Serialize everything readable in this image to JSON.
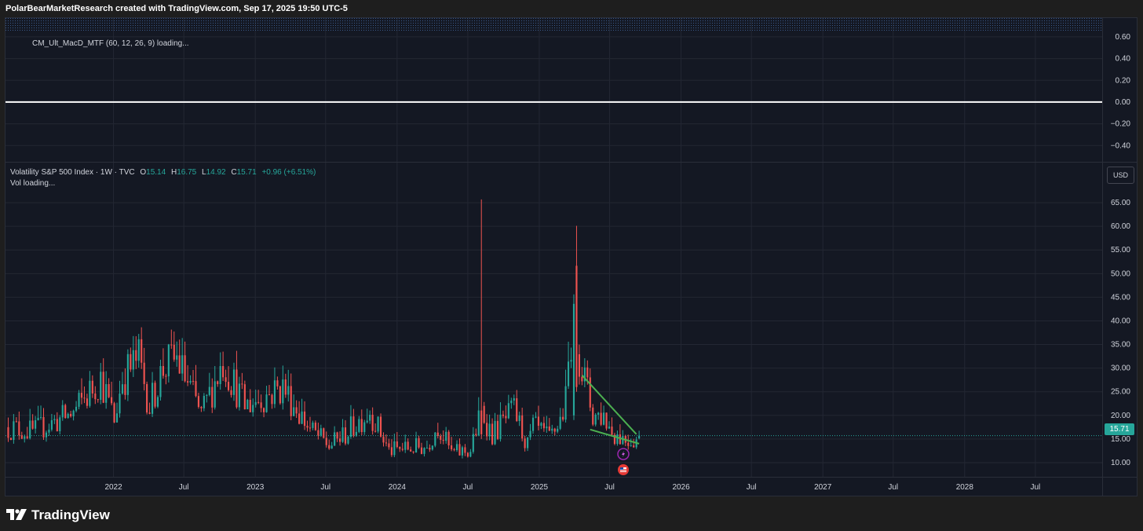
{
  "header": {
    "attribution": "PolarBearMarketResearch created with TradingView.com, Sep 17, 2025 19:50 UTC-5"
  },
  "macd_pane": {
    "label": "CM_Ult_MacD_MTF (60, 12, 26, 9) loading...",
    "axis_ticks": [
      "0.60",
      "0.40",
      "0.20",
      "0.00",
      "−0.20",
      "−0.40"
    ],
    "zero_line_color": "#ffffff"
  },
  "price_pane": {
    "symbol": "Volatility S&P 500 Index · 1W · TVC",
    "ohlc": {
      "o_label": "O",
      "o": "15.14",
      "h_label": "H",
      "h": "16.75",
      "l_label": "L",
      "l": "14.92",
      "c_label": "C",
      "c": "15.71",
      "change": "+0.96 (+6.51%)"
    },
    "vol_label": "Vol loading...",
    "currency": "USD",
    "last_price": "15.71"
  },
  "colors": {
    "up": "#26a69a",
    "down": "#ef5350",
    "trendline": "#4caf50",
    "grid": "#232733",
    "background": "#141823"
  },
  "icons": [
    "lightning-icon",
    "flag-icon"
  ],
  "footer": {
    "brand": "TradingView"
  },
  "chart_data": {
    "type": "candlestick",
    "title": "Volatility S&P 500 Index · 1W · TVC",
    "interval": "1W",
    "ylim": [
      7,
      70
    ],
    "y_ticks": [
      10,
      15,
      20,
      25,
      30,
      35,
      40,
      45,
      50,
      55,
      60,
      65
    ],
    "y_tick_labels": [
      "10.00",
      "15.00",
      "20.00",
      "25.00",
      "30.00",
      "35.00",
      "40.00",
      "45.00",
      "50.00",
      "55.00",
      "60.00",
      "65.00"
    ],
    "x_ticks": [
      {
        "date": "2022-01-01",
        "label": "2022"
      },
      {
        "date": "2022-07-01",
        "label": "Jul"
      },
      {
        "date": "2023-01-01",
        "label": "2023"
      },
      {
        "date": "2023-07-01",
        "label": "Jul"
      },
      {
        "date": "2024-01-01",
        "label": "2024"
      },
      {
        "date": "2024-07-01",
        "label": "Jul"
      },
      {
        "date": "2025-01-01",
        "label": "2025"
      },
      {
        "date": "2025-07-01",
        "label": "Jul"
      },
      {
        "date": "2026-01-01",
        "label": "2026"
      },
      {
        "date": "2026-07-01",
        "label": "Jul"
      },
      {
        "date": "2027-01-01",
        "label": "2027"
      },
      {
        "date": "2027-07-01",
        "label": "Jul"
      },
      {
        "date": "2028-01-01",
        "label": "2028"
      },
      {
        "date": "2028-07-01",
        "label": "Jul"
      }
    ],
    "x_range": [
      "2021-03-29",
      "2028-12-20"
    ],
    "series": [
      {
        "name": "Volatility S&P 500 Index",
        "key_points": [
          {
            "date": "2021-04-05",
            "close": 17.5
          },
          {
            "date": "2021-06-07",
            "close": 16.5
          },
          {
            "date": "2021-09-20",
            "close": 20.5
          },
          {
            "date": "2021-11-29",
            "close": 28
          },
          {
            "date": "2022-01-03",
            "close": 19
          },
          {
            "date": "2022-01-24",
            "close": 28
          },
          {
            "date": "2022-03-07",
            "close": 32
          },
          {
            "date": "2022-04-04",
            "close": 22
          },
          {
            "date": "2022-05-09",
            "close": 30
          },
          {
            "date": "2022-06-13",
            "close": 32
          },
          {
            "date": "2022-08-15",
            "close": 20
          },
          {
            "date": "2022-10-10",
            "close": 31.5
          },
          {
            "date": "2022-12-05",
            "close": 22
          },
          {
            "date": "2023-03-13",
            "close": 26
          },
          {
            "date": "2023-05-22",
            "close": 17
          },
          {
            "date": "2023-07-10",
            "close": 13.5
          },
          {
            "date": "2023-08-21",
            "close": 16
          },
          {
            "date": "2023-10-23",
            "close": 21
          },
          {
            "date": "2023-12-11",
            "close": 12.5
          },
          {
            "date": "2024-03-18",
            "close": 13.5
          },
          {
            "date": "2024-04-15",
            "close": 18
          },
          {
            "date": "2024-05-20",
            "close": 12
          },
          {
            "date": "2024-07-08",
            "close": 12.5
          },
          {
            "date": "2024-08-05",
            "close": 21
          },
          {
            "date": "2024-09-02",
            "close": 16
          },
          {
            "date": "2024-10-28",
            "close": 21
          },
          {
            "date": "2024-12-02",
            "close": 13.5
          },
          {
            "date": "2024-12-16",
            "close": 17.5
          },
          {
            "date": "2025-01-27",
            "close": 15
          },
          {
            "date": "2025-02-24",
            "close": 19
          },
          {
            "date": "2025-03-10",
            "close": 23
          },
          {
            "date": "2025-03-31",
            "close": 45
          },
          {
            "date": "2025-04-07",
            "close": 37
          },
          {
            "date": "2025-04-21",
            "close": 30
          },
          {
            "date": "2025-05-19",
            "close": 20
          },
          {
            "date": "2025-06-16",
            "close": 20
          },
          {
            "date": "2025-07-07",
            "close": 16.5
          },
          {
            "date": "2025-08-11",
            "close": 15
          },
          {
            "date": "2025-09-08",
            "close": 15
          },
          {
            "date": "2025-09-15",
            "close": 15.71
          }
        ]
      }
    ],
    "spikes": [
      {
        "date": "2024-08-05",
        "high": 65.7,
        "low": 16,
        "color": "down"
      },
      {
        "date": "2025-04-07",
        "high": 60.1,
        "low": 26,
        "color": "down"
      },
      {
        "date": "2025-03-31",
        "high": 45.6,
        "low": 20,
        "color": "up"
      }
    ],
    "last_candle": {
      "date": "2025-09-15",
      "open": 15.14,
      "high": 16.75,
      "low": 14.92,
      "close": 15.71,
      "change": 0.96,
      "change_pct": 6.51
    },
    "annotations": [
      {
        "type": "trendline",
        "color": "#4caf50",
        "from": {
          "date": "2025-04-21",
          "value": 28.5
        },
        "to": {
          "date": "2025-09-08",
          "value": 16
        }
      },
      {
        "type": "trendline",
        "color": "#4caf50",
        "from": {
          "date": "2025-05-12",
          "value": 17
        },
        "to": {
          "date": "2025-09-15",
          "value": 14
        }
      }
    ],
    "macd": {
      "ylim": [
        -0.55,
        0.65
      ],
      "y_ticks": [
        0.6,
        0.4,
        0.2,
        0,
        -0.2,
        -0.4
      ],
      "zero_line": 0
    },
    "grid": true,
    "legend": "top-left"
  }
}
